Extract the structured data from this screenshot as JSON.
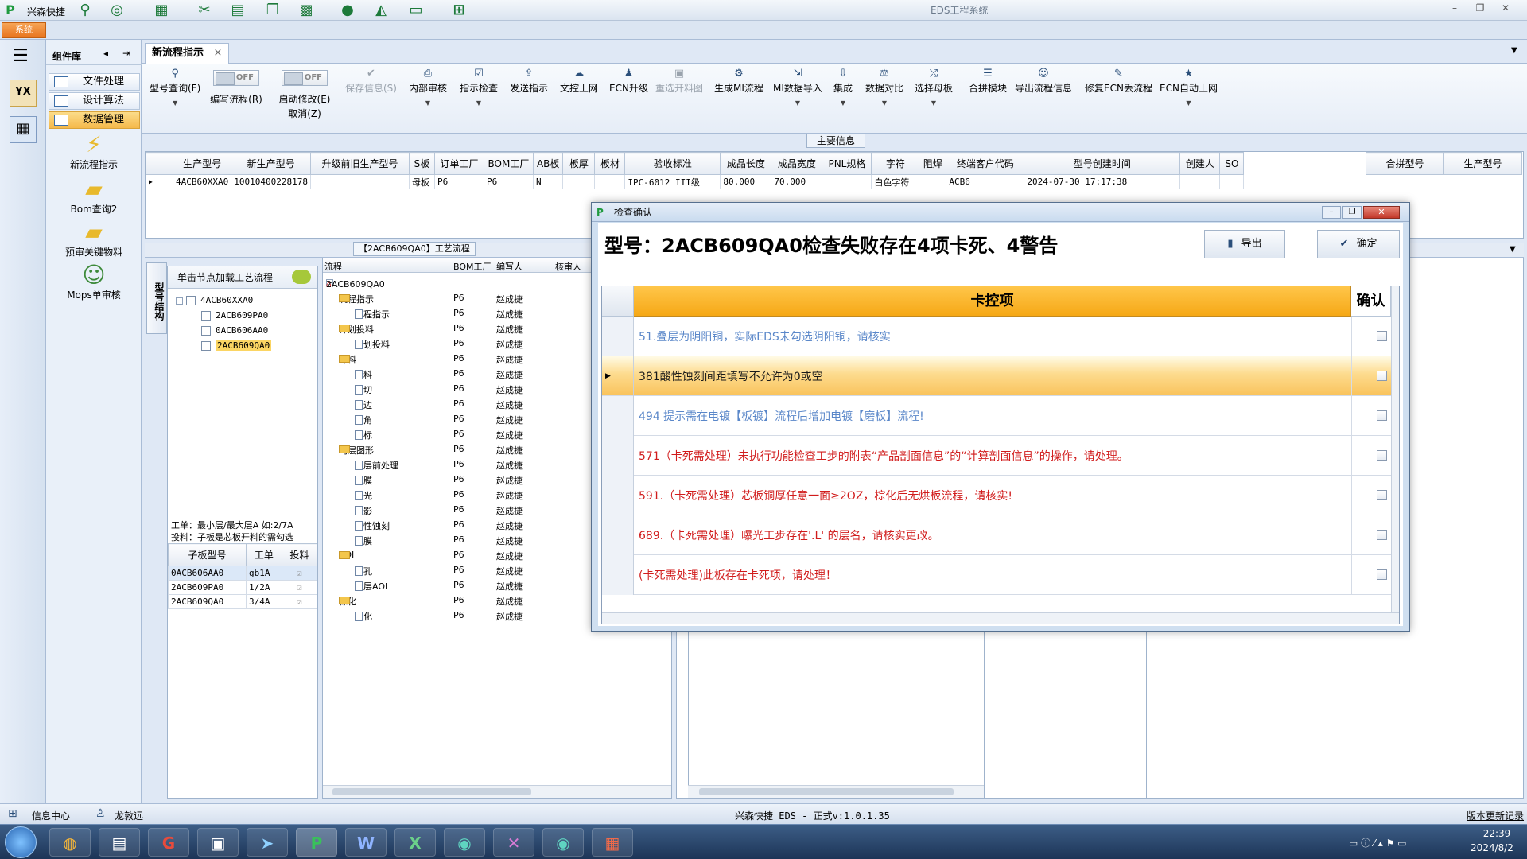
{
  "app": {
    "logo": "P",
    "company": "兴森快捷",
    "title": "EDS工程系统",
    "system_tab": "系统"
  },
  "window_controls": {
    "minimize": "–",
    "restore": "❐",
    "close": "✕"
  },
  "left_panel": {
    "title": "组件库",
    "menus": [
      "文件处理",
      "设计算法",
      "数据管理"
    ],
    "items": [
      "新流程指示",
      "Bom查询2",
      "预审关键物料",
      "Mops单审核"
    ]
  },
  "doc_tab": {
    "label": "新流程指示",
    "close": "×"
  },
  "ribbon": {
    "buttons": [
      {
        "label": "型号查询(F)",
        "icon": "search-icon"
      },
      {
        "label": "保存信息(S)",
        "icon": "check-icon",
        "disabled": true
      },
      {
        "label": "内部审核",
        "icon": "printer-icon"
      },
      {
        "label": "指示检查",
        "icon": "check-icon"
      },
      {
        "label": "发送指示",
        "icon": "upload-icon"
      },
      {
        "label": "文控上网",
        "icon": "cloud-upload-icon"
      },
      {
        "label": "ECN升级",
        "icon": "people-icon"
      },
      {
        "label": "重选开料图",
        "icon": "image-icon",
        "disabled": true
      },
      {
        "label": "生成MI流程",
        "icon": "gears-icon"
      },
      {
        "label": "MI数据导入",
        "icon": "import-icon"
      },
      {
        "label": "集成",
        "icon": "download-icon"
      },
      {
        "label": "数据对比",
        "icon": "compare-icon"
      },
      {
        "label": "选择母板",
        "icon": "shuffle-icon"
      },
      {
        "label": "合拼模块",
        "icon": "list-icon"
      },
      {
        "label": "导出流程信息",
        "icon": "smiley-icon"
      },
      {
        "label": "修复ECN丢流程",
        "icon": "wrench-icon"
      },
      {
        "label": "ECN自动上网",
        "icon": "star-icon"
      }
    ],
    "toggles": [
      {
        "state": "OFF",
        "label": "编写流程(R)"
      },
      {
        "state": "OFF",
        "label": "启动修改(E)",
        "sublabel": "取消(Z)"
      }
    ]
  },
  "main_info": {
    "section_label": "主要信息",
    "headers": [
      "生产型号",
      "新生产型号",
      "升级前旧生产型号",
      "S板",
      "订单工厂",
      "BOM工厂",
      "AB板",
      "板厚",
      "板材",
      "验收标准",
      "成品长度",
      "成品宽度",
      "PNL规格",
      "字符",
      "阻焊",
      "终端客户代码",
      "型号创建时间",
      "创建人",
      "SO"
    ],
    "row": [
      "4ACB60XXA0",
      "10010400228178",
      "",
      "母板",
      "P6",
      "P6",
      "N",
      "",
      "",
      "IPC-6012 III级",
      "80.000",
      "70.000",
      "",
      "白色字符",
      "",
      "ACB6",
      "2024-07-30 17:17:38",
      "",
      ""
    ],
    "merge_headers": [
      "合拼型号",
      "生产型号"
    ]
  },
  "process_section": {
    "title": "【2ACB609QA0】工艺流程",
    "struct_tab": "型号结构",
    "load_hint": "单击节点加载工艺流程",
    "tree": [
      "4ACB60XXA0",
      "2ACB609PA0",
      "0ACB606AA0",
      "2ACB609QA0"
    ],
    "note_line1": "工单：最小层/最大层A 如:2/7A",
    "note_line2": "投料：子板是芯板开料的需勾选",
    "sub_headers": [
      "子板型号",
      "工单",
      "投料"
    ],
    "sub_rows": [
      {
        "model": "0ACB606AA0",
        "order": "gb1A"
      },
      {
        "model": "2ACB609PA0",
        "order": "1/2A"
      },
      {
        "model": "2ACB609QA0",
        "order": "3/4A"
      }
    ],
    "proc_headers": [
      "流程",
      "BOM工厂",
      "编写人",
      "核审人"
    ],
    "proc_root": "2ACB609QA0",
    "proc_rows": [
      {
        "name": "流程指示",
        "factory": "P6",
        "writer": "赵成捷"
      },
      {
        "name": "流程指示",
        "factory": "P6",
        "writer": "赵成捷"
      },
      {
        "name": "计划投料",
        "factory": "P6",
        "writer": "赵成捷"
      },
      {
        "name": "计划投料",
        "factory": "P6",
        "writer": "赵成捷"
      },
      {
        "name": "开料",
        "factory": "P6",
        "writer": "赵成捷"
      },
      {
        "name": "开料",
        "factory": "P6",
        "writer": "赵成捷"
      },
      {
        "name": "裁切",
        "factory": "P6",
        "writer": "赵成捷"
      },
      {
        "name": "磨边",
        "factory": "P6",
        "writer": "赵成捷"
      },
      {
        "name": "圆角",
        "factory": "P6",
        "writer": "赵成捷"
      },
      {
        "name": "打标",
        "factory": "P6",
        "writer": "赵成捷"
      },
      {
        "name": "内层图形",
        "factory": "P6",
        "writer": "赵成捷"
      },
      {
        "name": "内层前处理",
        "factory": "P6",
        "writer": "赵成捷"
      },
      {
        "name": "贴膜",
        "factory": "P6",
        "writer": "赵成捷"
      },
      {
        "name": "曝光",
        "factory": "P6",
        "writer": "赵成捷"
      },
      {
        "name": "显影",
        "factory": "P6",
        "writer": "赵成捷"
      },
      {
        "name": "酸性蚀刻",
        "factory": "P6",
        "writer": "赵成捷"
      },
      {
        "name": "退膜",
        "factory": "P6",
        "writer": "赵成捷"
      },
      {
        "name": "AOI",
        "factory": "P6",
        "writer": "赵成捷"
      },
      {
        "name": "冲孔",
        "factory": "P6",
        "writer": "赵成捷"
      },
      {
        "name": "内层AOI",
        "factory": "P6",
        "writer": "赵成捷"
      },
      {
        "name": "棕化",
        "factory": "P6",
        "writer": "赵成捷"
      },
      {
        "name": "棕化",
        "factory": "P6",
        "writer": "赵成捷"
      }
    ]
  },
  "dialog": {
    "title": "检查确认",
    "heading": "型号：2ACB609QA0检查失败存在4项卡死、4警告",
    "export_label": "导出",
    "confirm_label": "确定",
    "col_item": "卡控项",
    "col_confirm": "确认",
    "rows": [
      {
        "text": "51.叠层为阴阳铜，实际EDS未勾选阴阳铜，请核实",
        "level": "warning"
      },
      {
        "text": "381酸性蚀刻间距填写不允许为0或空",
        "level": "selected"
      },
      {
        "text": "494 提示需在电镀【板镀】流程后增加电镀【磨板】流程!",
        "level": "warning"
      },
      {
        "text": "571（卡死需处理）未执行功能检查工步的附表“产品剖面信息”的“计算剖面信息”的操作，请处理。",
        "level": "error"
      },
      {
        "text": "591.（卡死需处理）芯板铜厚任意一面≥2OZ，棕化后无烘板流程，请核实!",
        "level": "error"
      },
      {
        "text": "689.（卡死需处理）曝光工步存在'.L' 的层名，请核实更改。",
        "level": "error"
      },
      {
        "text": "(卡死需处理)此板存在卡死项，请处理！",
        "level": "error"
      }
    ]
  },
  "status": {
    "info_center": "信息中心",
    "user": "龙敦远",
    "center": "兴森快捷 EDS - 正式v:1.0.1.35",
    "right": "版本更新记录"
  },
  "taskbar": {
    "time": "22:39",
    "date": "2024/8/2"
  },
  "colors": {
    "accent": "#f6a816",
    "warning_text": "#5a87c9",
    "error_text": "#d11c1c",
    "selected_row": "#f9c35c"
  }
}
